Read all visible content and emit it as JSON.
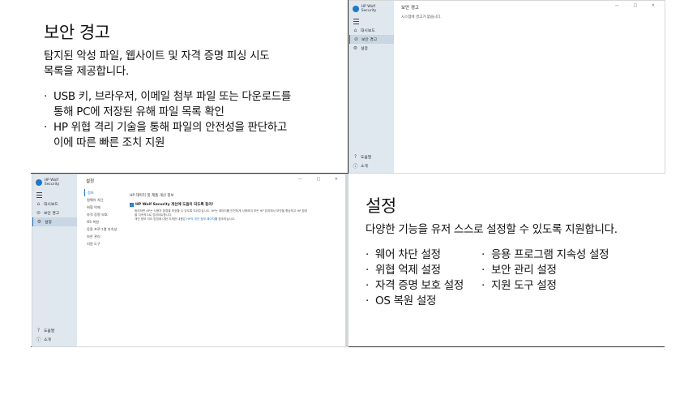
{
  "panel1": {
    "title": "보안 경고",
    "sub1": "탐지된 악성 파일, 웹사이트 및 자격 증명 피싱 시도",
    "sub2": "목록을 제공합니다.",
    "b1a": "USB 키, 브라우저, 이메일 첨부 파일 또는 다운로드를",
    "b1b": "통해 PC에 저장된 유해 파일 목록 확인",
    "b2a": "HP 위협 격리 기술을 통해 파일의 안전성을 판단하고",
    "b2b": "이에 따른 빠른 조치 지원"
  },
  "panel4": {
    "title": "설정",
    "sub": "다양한 기능을 유저 스스로 설정할 수 있도록 지원합니다.",
    "left": [
      "웨어 차단 설정",
      "위협 억제 설정",
      "자격 증명 보호 설정",
      "OS 복원 설정"
    ],
    "right": [
      "응용 프로그램 지속성 설정",
      "보안 관리 설정",
      "지원 도구 설정"
    ]
  },
  "app": {
    "brand": "HP Wolf Security",
    "nav_dashboard": "대시보드",
    "nav_alerts": "보안 경고",
    "nav_settings": "설정",
    "nav_help": "도움말",
    "nav_about": "소개",
    "win_controls": "— □ ✕"
  },
  "win1": {
    "title": "보안 경고",
    "message": "시스템에 경고가 없습니다."
  },
  "win2": {
    "title": "설정",
    "subnav": [
      "정보",
      "멀웨어 차단",
      "위협 억제",
      "자격 증명 보호",
      "OS 복원",
      "응용 프로그램 지속성",
      "보안 관리",
      "지원 도구"
    ],
    "section": "HP 데이터 및 제품 개선 정보",
    "checkbox_label": "HP Wolf Security 개선에 도움이 되도록 동의!",
    "body1": "동의하면 HP는 사용자 환경을 보호할 수 있도록 도와주십시오. HP는 데이터를 안전하게 사용하여 모든 HP 장치에서 보안을 향상하고 HP 환경",
    "body2": "을 지속적으로 업데이트합니다.",
    "body3": "개인 정보 처리 방침에 대한 자세한 내용은",
    "link": "HP의 개인 정보 페이지",
    "body4": "를 참조하십시오."
  }
}
